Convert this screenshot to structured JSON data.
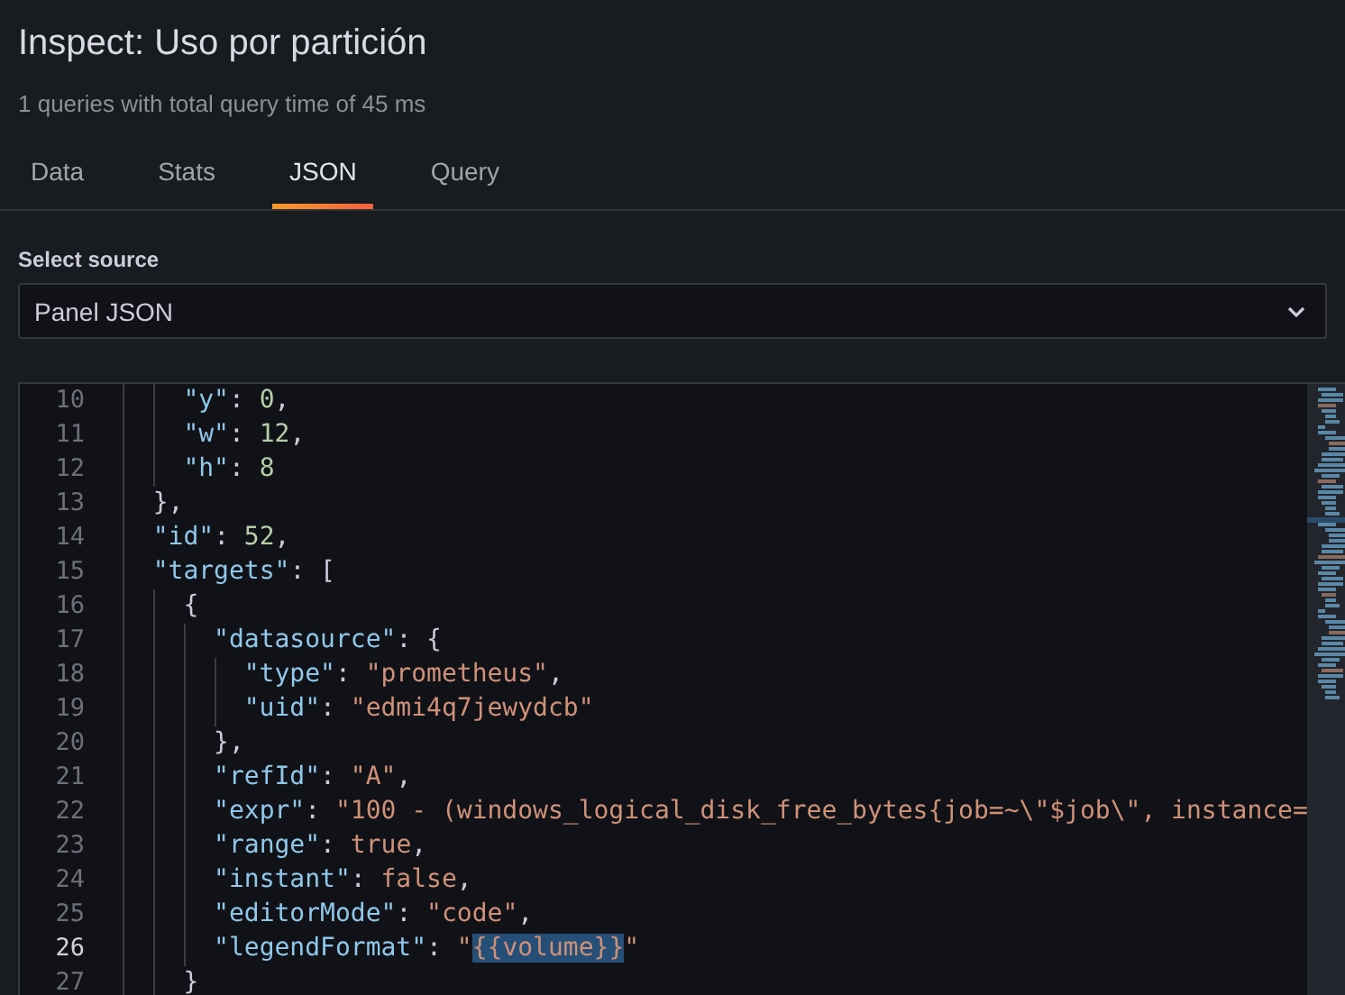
{
  "header": {
    "title": "Inspect: Uso por partición",
    "subtitle": "1 queries with total query time of 45 ms"
  },
  "tabs": [
    {
      "label": "Data",
      "selected": false
    },
    {
      "label": "Stats",
      "selected": false
    },
    {
      "label": "JSON",
      "selected": true
    },
    {
      "label": "Query",
      "selected": false
    }
  ],
  "source": {
    "label": "Select source",
    "value": "Panel JSON"
  },
  "editor": {
    "lines": [
      {
        "children": [
          {
            "number": "10",
            "current": false,
            "tokens": [
              {
                "kind": "key",
                "text": "\"y\""
              },
              {
                "kind": "punct",
                "text": ": "
              },
              {
                "kind": "number",
                "text": "0"
              },
              {
                "kind": "punct",
                "text": ","
              }
            ]
          },
          {
            "number": "11",
            "current": false,
            "tokens": [
              {
                "kind": "key",
                "text": "\"w\""
              },
              {
                "kind": "punct",
                "text": ": "
              },
              {
                "kind": "number",
                "text": "12"
              },
              {
                "kind": "punct",
                "text": ","
              }
            ]
          },
          {
            "number": "12",
            "current": false,
            "tokens": [
              {
                "kind": "key",
                "text": "\"h\""
              },
              {
                "kind": "punct",
                "text": ": "
              },
              {
                "kind": "number",
                "text": "8"
              }
            ]
          }
        ]
      },
      {
        "number": "13",
        "current": false,
        "tokens": [
          {
            "kind": "punct",
            "text": "},"
          }
        ]
      },
      {
        "number": "14",
        "current": false,
        "tokens": [
          {
            "kind": "key",
            "text": "\"id\""
          },
          {
            "kind": "punct",
            "text": ": "
          },
          {
            "kind": "number",
            "text": "52"
          },
          {
            "kind": "punct",
            "text": ","
          }
        ]
      },
      {
        "number": "15",
        "current": false,
        "tokens": [
          {
            "kind": "key",
            "text": "\"targets\""
          },
          {
            "kind": "punct",
            "text": ": ["
          }
        ],
        "children": [
          {
            "number": "16",
            "current": false,
            "tokens": [
              {
                "kind": "punct",
                "text": "{"
              }
            ],
            "children": [
              {
                "number": "17",
                "current": false,
                "tokens": [
                  {
                    "kind": "key",
                    "text": "\"datasource\""
                  },
                  {
                    "kind": "punct",
                    "text": ": {"
                  }
                ],
                "children": [
                  {
                    "number": "18",
                    "current": false,
                    "tokens": [
                      {
                        "kind": "key",
                        "text": "\"type\""
                      },
                      {
                        "kind": "punct",
                        "text": ": "
                      },
                      {
                        "kind": "string",
                        "text": "\"prometheus\""
                      },
                      {
                        "kind": "punct",
                        "text": ","
                      }
                    ]
                  },
                  {
                    "number": "19",
                    "current": false,
                    "tokens": [
                      {
                        "kind": "key",
                        "text": "\"uid\""
                      },
                      {
                        "kind": "punct",
                        "text": ": "
                      },
                      {
                        "kind": "string",
                        "text": "\"edmi4q7jewydcb\""
                      }
                    ]
                  }
                ]
              },
              {
                "number": "20",
                "current": false,
                "tokens": [
                  {
                    "kind": "punct",
                    "text": "},"
                  }
                ]
              },
              {
                "number": "21",
                "current": false,
                "tokens": [
                  {
                    "kind": "key",
                    "text": "\"refId\""
                  },
                  {
                    "kind": "punct",
                    "text": ": "
                  },
                  {
                    "kind": "string",
                    "text": "\"A\""
                  },
                  {
                    "kind": "punct",
                    "text": ","
                  }
                ]
              },
              {
                "number": "22",
                "current": false,
                "tokens": [
                  {
                    "kind": "key",
                    "text": "\"expr\""
                  },
                  {
                    "kind": "punct",
                    "text": ": "
                  },
                  {
                    "kind": "string",
                    "text": "\"100 - (windows_logical_disk_free_bytes{job=~\\\"$job\\\", instance="
                  }
                ]
              },
              {
                "number": "23",
                "current": false,
                "tokens": [
                  {
                    "kind": "key",
                    "text": "\"range\""
                  },
                  {
                    "kind": "punct",
                    "text": ": "
                  },
                  {
                    "kind": "string",
                    "text": "true"
                  },
                  {
                    "kind": "punct",
                    "text": ","
                  }
                ]
              },
              {
                "number": "24",
                "current": false,
                "tokens": [
                  {
                    "kind": "key",
                    "text": "\"instant\""
                  },
                  {
                    "kind": "punct",
                    "text": ": "
                  },
                  {
                    "kind": "string",
                    "text": "false"
                  },
                  {
                    "kind": "punct",
                    "text": ","
                  }
                ]
              },
              {
                "number": "25",
                "current": false,
                "tokens": [
                  {
                    "kind": "key",
                    "text": "\"editorMode\""
                  },
                  {
                    "kind": "punct",
                    "text": ": "
                  },
                  {
                    "kind": "string",
                    "text": "\"code\""
                  },
                  {
                    "kind": "punct",
                    "text": ","
                  }
                ]
              },
              {
                "number": "26",
                "current": true,
                "tokens": [
                  {
                    "kind": "key",
                    "text": "\"legendFormat\""
                  },
                  {
                    "kind": "punct",
                    "text": ": "
                  },
                  {
                    "kind": "string",
                    "text": "\""
                  },
                  {
                    "kind": "selection",
                    "text": "{{volume}}"
                  },
                  {
                    "kind": "string",
                    "text": "\""
                  }
                ]
              }
            ]
          },
          {
            "number": "27",
            "current": false,
            "tokens": [
              {
                "kind": "punct",
                "text": "}"
              }
            ]
          }
        ]
      }
    ]
  }
}
